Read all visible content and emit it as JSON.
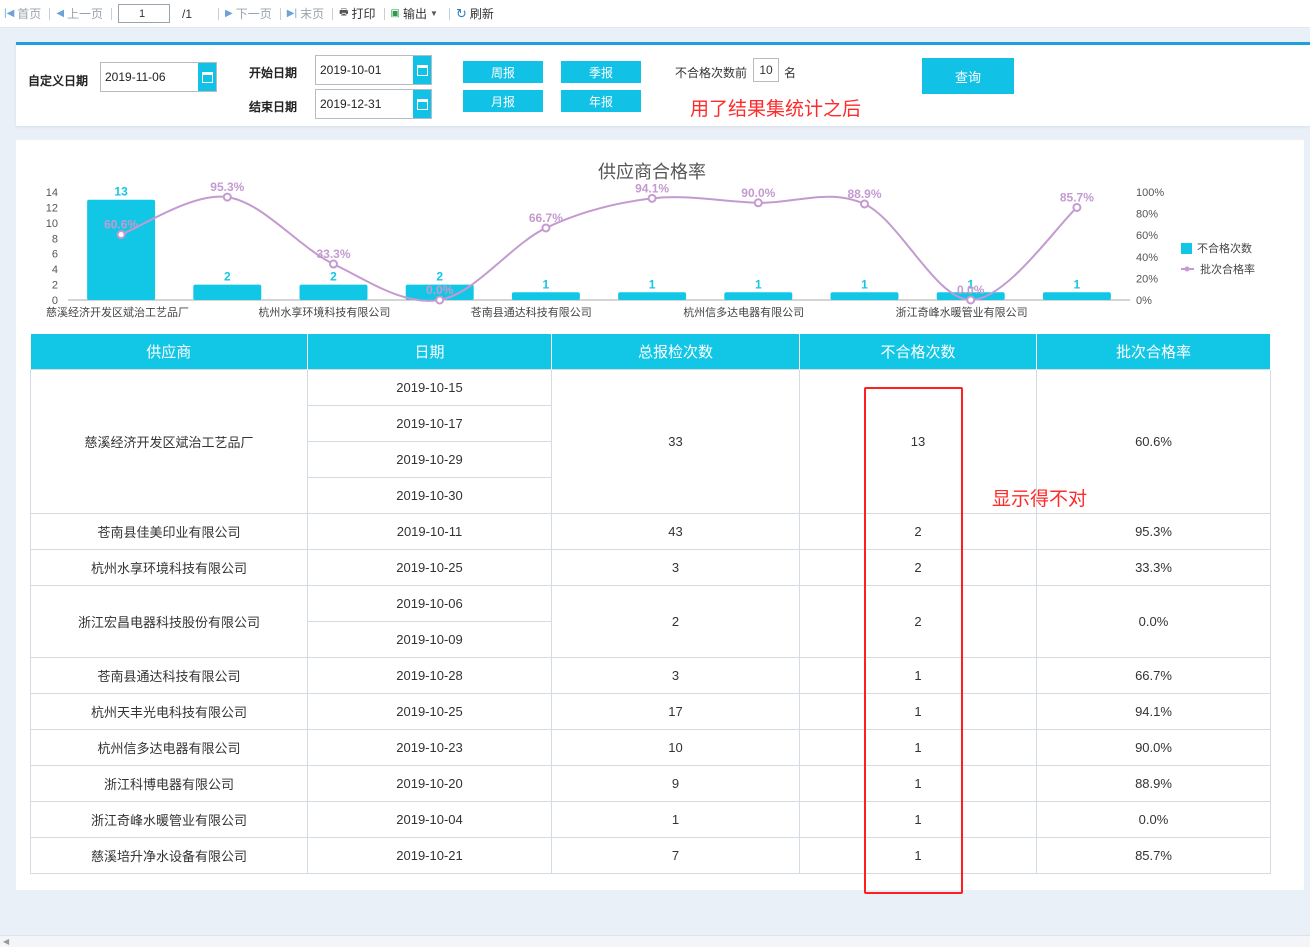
{
  "toolbar": {
    "first": "首页",
    "prev": "上一页",
    "page_value": "1",
    "page_total": "/1",
    "next": "下一页",
    "last": "末页",
    "print": "打印",
    "export": "输出",
    "refresh": "刷新"
  },
  "filters": {
    "custom_date_label": "自定义日期",
    "custom_date": "2019-11-06",
    "start_label": "开始日期",
    "start_date": "2019-10-01",
    "end_label": "结束日期",
    "end_date": "2019-12-31",
    "weekly": "周报",
    "quarterly": "季报",
    "monthly": "月报",
    "yearly": "年报",
    "topn_prefix": "不合格次数前",
    "topn_value": "10",
    "topn_suffix": "名",
    "query": "查询"
  },
  "annotations": {
    "top_note": "用了结果集统计之后",
    "column_note": "显示得不对"
  },
  "chart_data": {
    "type": "bar",
    "title": "供应商合格率",
    "categories": [
      "慈溪经济开发区斌治工艺品厂",
      "苍南县佳美印业有限公司",
      "杭州水享环境科技有限公司",
      "浙江宏昌电器科技股份有限公司",
      "苍南县通达科技有限公司",
      "杭州天丰光电科技有限公司",
      "杭州信多达电器有限公司",
      "浙江科博电器有限公司",
      "浙江奇峰水暖管业有限公司",
      "慈溪培升净水设备有限公司"
    ],
    "visible_category_labels": [
      "慈溪经济开发区斌治工艺品厂",
      "杭州水享环境科技有限公司",
      "苍南县通达科技有限公司",
      "杭州信多达电器有限公司",
      "浙江奇峰水暖管业有限公司"
    ],
    "series": [
      {
        "name": "不合格次数",
        "type": "bar",
        "axis": "left",
        "color": "#12c7e6",
        "values": [
          13,
          2,
          2,
          2,
          1,
          1,
          1,
          1,
          1,
          1
        ]
      },
      {
        "name": "批次合格率",
        "type": "line",
        "axis": "right",
        "color": "#c49ad0",
        "values": [
          60.6,
          95.3,
          33.3,
          0.0,
          66.7,
          94.1,
          90.0,
          88.9,
          0.0,
          85.7
        ]
      }
    ],
    "bar_labels": [
      "13",
      "2",
      "2",
      "2",
      "1",
      "1",
      "1",
      "1",
      "1",
      "1"
    ],
    "line_labels": [
      "60.6%",
      "95.3%",
      "33.3%",
      "0.0%",
      "66.7%",
      "94.1%",
      "90.0%",
      "88.9%",
      "0.0%",
      "85.7%"
    ],
    "left_ticks": [
      "0",
      "2",
      "4",
      "6",
      "8",
      "10",
      "12",
      "14"
    ],
    "right_ticks": [
      "0%",
      "20%",
      "40%",
      "60%",
      "80%",
      "100%"
    ],
    "ylim_left": [
      0,
      14
    ],
    "ylim_right": [
      0,
      100
    ],
    "legend_position": "right",
    "grid": false
  },
  "table": {
    "headers": [
      "供应商",
      "日期",
      "总报检次数",
      "不合格次数",
      "批次合格率"
    ],
    "groups": [
      {
        "supplier": "慈溪经济开发区斌治工艺品厂",
        "dates": [
          "2019-10-15",
          "2019-10-17",
          "2019-10-29",
          "2019-10-30"
        ],
        "total": "33",
        "failed": "13",
        "rate": "60.6%"
      },
      {
        "supplier": "苍南县佳美印业有限公司",
        "dates": [
          "2019-10-11"
        ],
        "total": "43",
        "failed": "2",
        "rate": "95.3%"
      },
      {
        "supplier": "杭州水享环境科技有限公司",
        "dates": [
          "2019-10-25"
        ],
        "total": "3",
        "failed": "2",
        "rate": "33.3%"
      },
      {
        "supplier": "浙江宏昌电器科技股份有限公司",
        "dates": [
          "2019-10-06",
          "2019-10-09"
        ],
        "total": "2",
        "failed": "2",
        "rate": "0.0%"
      },
      {
        "supplier": "苍南县通达科技有限公司",
        "dates": [
          "2019-10-28"
        ],
        "total": "3",
        "failed": "1",
        "rate": "66.7%"
      },
      {
        "supplier": "杭州天丰光电科技有限公司",
        "dates": [
          "2019-10-25"
        ],
        "total": "17",
        "failed": "1",
        "rate": "94.1%"
      },
      {
        "supplier": "杭州信多达电器有限公司",
        "dates": [
          "2019-10-23"
        ],
        "total": "10",
        "failed": "1",
        "rate": "90.0%"
      },
      {
        "supplier": "浙江科博电器有限公司",
        "dates": [
          "2019-10-20"
        ],
        "total": "9",
        "failed": "1",
        "rate": "88.9%"
      },
      {
        "supplier": "浙江奇峰水暖管业有限公司",
        "dates": [
          "2019-10-04"
        ],
        "total": "1",
        "failed": "1",
        "rate": "0.0%"
      },
      {
        "supplier": "慈溪培升净水设备有限公司",
        "dates": [
          "2019-10-21"
        ],
        "total": "7",
        "failed": "1",
        "rate": "85.7%"
      }
    ]
  }
}
